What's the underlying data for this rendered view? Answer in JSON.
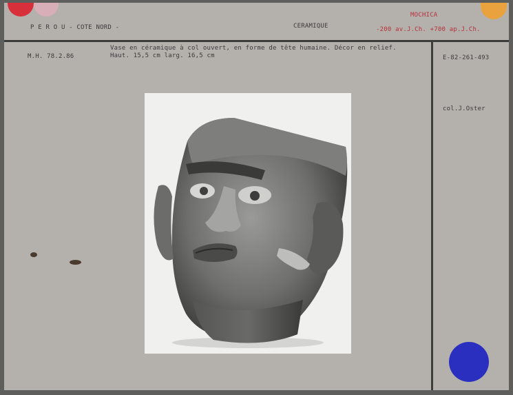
{
  "header": {
    "location": "P E R O U -   COTE NORD -",
    "category": "CERAMIQUE",
    "culture": "MOCHICA",
    "dates": "-200 av.J.Ch.  +700 ap.J.Ch."
  },
  "record": {
    "inventory": "M.H. 78.2.86",
    "description": "Vase en céramique à col ouvert, en forme de tête humaine. Décor en relief.",
    "dimensions": "Haut. 15,5 cm   larg. 16,5 cm",
    "photo_number": "E-82-261-493",
    "collection": "col.J.Oster"
  },
  "colors": {
    "dot_red": "#d8303a",
    "dot_pink": "#d8aeb8",
    "dot_orange": "#eaa23e",
    "dot_blue": "#2a2fbf"
  }
}
